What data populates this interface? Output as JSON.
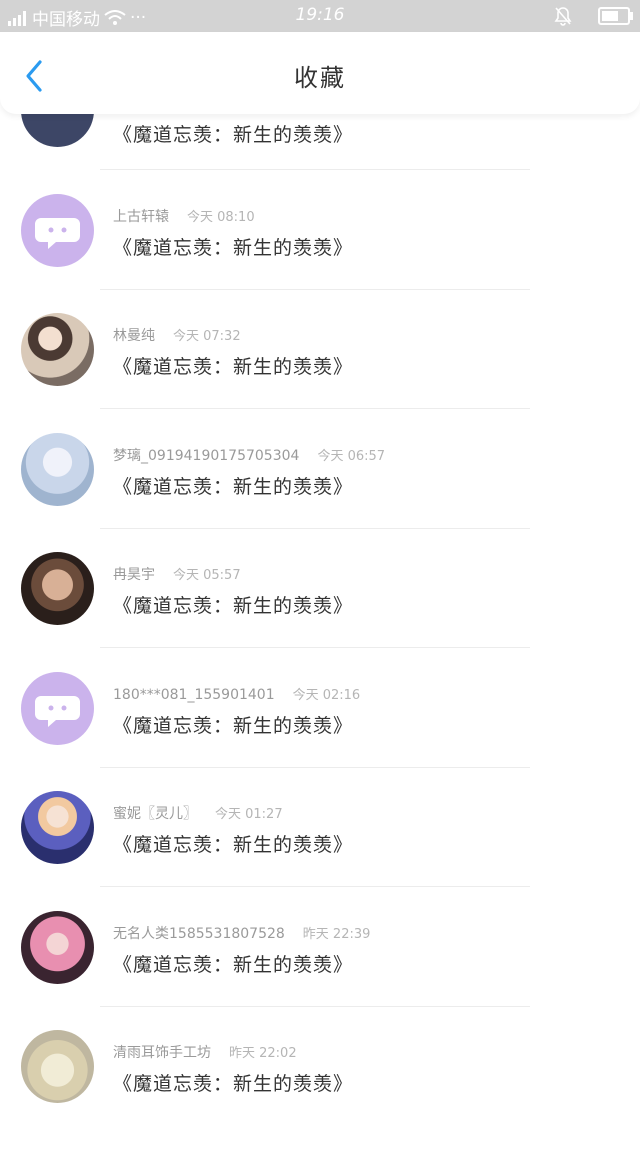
{
  "status_bar": {
    "carrier": "中国移动",
    "wifi_icon": "wifi-icon",
    "more": "···",
    "time": "19:16",
    "silent_icon": "bell-off-icon",
    "battery_icon": "battery-icon"
  },
  "header": {
    "back_icon": "chevron-left-icon",
    "title": "收藏",
    "accent_color": "#2b9bf0"
  },
  "items": [
    {
      "name": "",
      "time": "",
      "title": "《魔道忘羡：新生的羡羡》",
      "avatar": "av-top"
    },
    {
      "name": "上古轩辕",
      "time": "今天 08:10",
      "title": "《魔道忘羡：新生的羡羡》",
      "avatar": "av-chat"
    },
    {
      "name": "林曼纯",
      "time": "今天 07:32",
      "title": "《魔道忘羡：新生的羡羡》",
      "avatar": "av-photo1"
    },
    {
      "name": "梦璃_09194190175705304",
      "time": "今天 06:57",
      "title": "《魔道忘羡：新生的羡羡》",
      "avatar": "av-anime1"
    },
    {
      "name": "冉昊宇",
      "time": "今天 05:57",
      "title": "《魔道忘羡：新生的羡羡》",
      "avatar": "av-photo2"
    },
    {
      "name": "180***081_155901401",
      "time": "今天 02:16",
      "title": "《魔道忘羡：新生的羡羡》",
      "avatar": "av-chat"
    },
    {
      "name": "蜜妮〖灵儿〗",
      "time": "今天 01:27",
      "title": "《魔道忘羡：新生的羡羡》",
      "avatar": "av-anime2"
    },
    {
      "name": "无名人类1585531807528",
      "time": "昨天 22:39",
      "title": "《魔道忘羡：新生的羡羡》",
      "avatar": "av-anime3"
    },
    {
      "name": "清雨耳饰手工坊",
      "time": "昨天 22:02",
      "title": "《魔道忘羡：新生的羡羡》",
      "avatar": "av-tree"
    }
  ]
}
